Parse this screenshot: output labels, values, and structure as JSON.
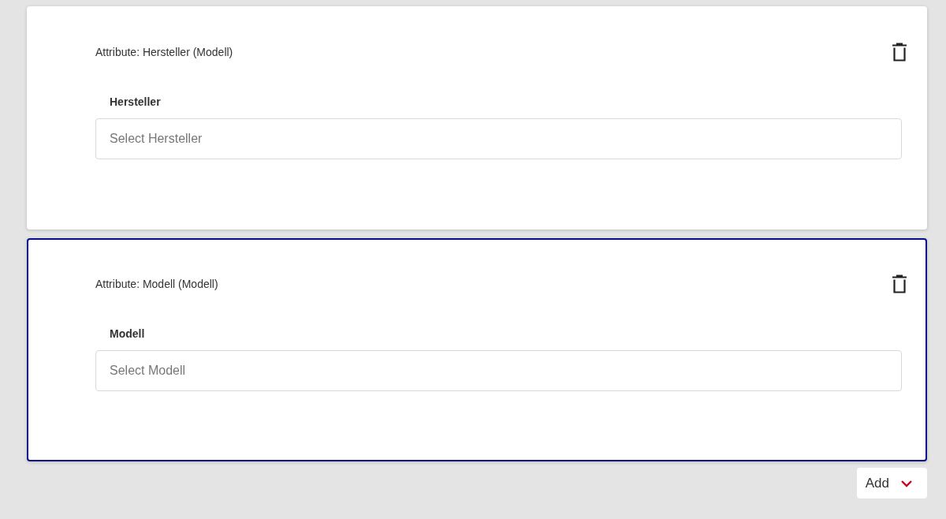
{
  "attributes": [
    {
      "title": "Attribute: Hersteller (Modell)",
      "label": "Hersteller",
      "placeholder": "Select Hersteller",
      "selected": false
    },
    {
      "title": "Attribute: Modell (Modell)",
      "label": "Modell",
      "placeholder": "Select Modell",
      "selected": true
    }
  ],
  "add_button": {
    "label": "Add"
  }
}
